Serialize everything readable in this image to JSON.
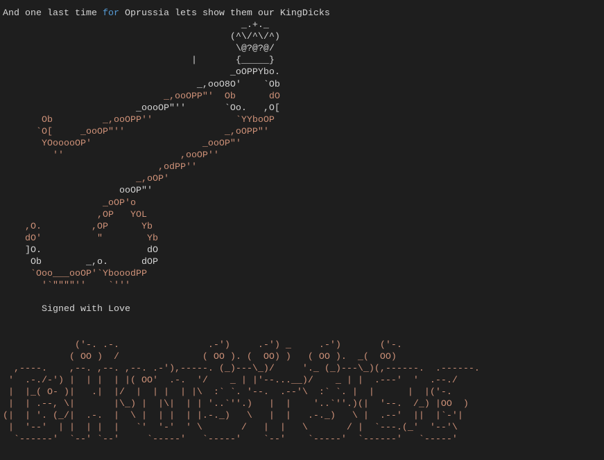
{
  "colors": {
    "background": "#1e1e1e",
    "text": "#d4d4d4",
    "string": "#ce9178",
    "keyword": "#569cd6",
    "comment": "#6a9955"
  },
  "title": {
    "before": "And one last time ",
    "keyword": "for",
    "after": " Oprussia lets show them our KingDicks"
  },
  "art": [
    {
      "tone": "w",
      "text": "                                           _.+._"
    },
    {
      "tone": "w",
      "text": "                                         (^\\/^\\/^)"
    },
    {
      "tone": "w",
      "text": "                                          \\@?@?@/"
    },
    {
      "tone": "w",
      "text": "                                  |       {_____}"
    },
    {
      "tone": "w",
      "text": "                                         _oOPPYbo."
    },
    {
      "tone": "w",
      "text": "                                   _,ooO8O'    `Ob"
    },
    {
      "tone": "o",
      "text": "                             _,ooOPP\"'  Ob      dO"
    },
    {
      "tone": "w",
      "text": "                        _oooOP\"''       `Oo.   ,O["
    },
    {
      "tone": "o",
      "text": "       Ob         _,ooOPP''               `YYboOP"
    },
    {
      "tone": "o",
      "text": "      `O[     _ooOP\"''                  _,oOPP\"'"
    },
    {
      "tone": "o",
      "text": "       YOooooOP'                    _ooOP\"'"
    },
    {
      "tone": "o",
      "text": "         ''                     ,ooOP''"
    },
    {
      "tone": "o",
      "text": "                            ,odPP''"
    },
    {
      "tone": "o",
      "text": "                        _,oOP'"
    },
    {
      "tone": "w",
      "text": "                     ooOP\"'"
    },
    {
      "tone": "o",
      "text": "                  _oOP'o"
    },
    {
      "tone": "o",
      "text": "                 ,OP   YOL"
    },
    {
      "tone": "o",
      "text": "    ,O.         ,OP      Yb"
    },
    {
      "tone": "o",
      "text": "    dO'          \"        Yb"
    },
    {
      "tone": "w",
      "text": "    ]O.                   dO"
    },
    {
      "tone": "w",
      "text": "     Ob        _,o.      dOP"
    },
    {
      "tone": "o",
      "text": "     `Ooo___ooOP'`YbooodPP"
    },
    {
      "tone": "o",
      "text": "       '`\"\"\"\"''    `'''"
    }
  ],
  "signature": "       Signed with Love",
  "banner": [
    "             ('-. .-.                .-')     .-') _     .-')       ('-.",
    "            ( OO )  /               ( OO ). (  OO) )   ( OO ).  _(  OO)",
    "  ,----.    ,--. ,--. ,--. .-'),-----. (_)---\\_)/     '._ (_)---\\_)(,------.  .------.",
    " '  .-./-') |  | |  | |( OO'  .-.  '/    _ | |'--...__)/    _ | |  .---'  '  .--./",
    " |  |_( O- )|   .|  |/  |  | |  | |\\  :` `. '--.  .--'\\  :` `. |  |      |  |('-.",
    " |  | .--, \\|       |\\_) |  |\\|  | | '..`''.)   |  |    '..`''.)(|  '--.  /_) |OO  )",
    "(|  | '. (_/|  .-.  |  \\ |  | |  | |.-._)   \\   |  |   .-._)   \\ |  .--'  ||  |`-'|",
    " |  '--'  | |  | |  |   `'  '-'  ' \\       /   |  |   \\       / |  `---.(_'  '--'\\",
    "  `------'  `--' `--'     `-----'   `-----'    `--'    `-----'  `------'   `-----'"
  ]
}
